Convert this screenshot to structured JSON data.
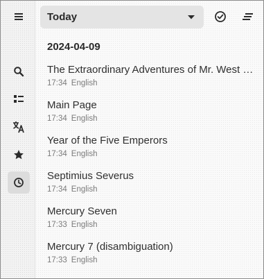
{
  "sidebar": {
    "items": [
      {
        "name": "menu",
        "icon": "hamburger-menu-icon"
      },
      {
        "name": "search",
        "icon": "search-icon"
      },
      {
        "name": "contents",
        "icon": "list-icon"
      },
      {
        "name": "language",
        "icon": "translate-icon"
      },
      {
        "name": "saved",
        "icon": "star-icon"
      },
      {
        "name": "history",
        "icon": "clock-icon",
        "active": true
      }
    ]
  },
  "header": {
    "filter_label": "Today",
    "filter_icon": "chevron-down-icon",
    "mark_icon": "check-circle-icon",
    "sort_icon": "sort-lines-icon"
  },
  "history": {
    "date": "2024-04-09",
    "items": [
      {
        "title": "The Extraordinary Adventures of Mr. West in the Land of the Bolsheviks",
        "time": "17:34",
        "language": "English"
      },
      {
        "title": "Main Page",
        "time": "17:34",
        "language": "English"
      },
      {
        "title": "Year of the Five Emperors",
        "time": "17:34",
        "language": "English"
      },
      {
        "title": "Septimius Severus",
        "time": "17:34",
        "language": "English"
      },
      {
        "title": "Mercury Seven",
        "time": "17:33",
        "language": "English"
      },
      {
        "title": "Mercury 7 (disambiguation)",
        "time": "17:33",
        "language": "English"
      }
    ]
  },
  "colors": {
    "active_bg": "#dcdcdc",
    "dropdown_bg": "#e4e4e4",
    "text": "#2f2f2f",
    "meta_text": "#7a7a7a"
  }
}
